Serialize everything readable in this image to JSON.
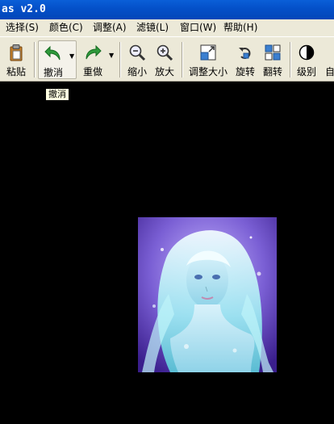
{
  "window": {
    "title_fragment": "as v2.0"
  },
  "menu": [
    "选择(S)",
    "颜色(C)",
    "调整(A)",
    "滤镜(L)",
    "窗口(W)",
    "帮助(H)"
  ],
  "toolbar": {
    "paste": "粘贴",
    "undo": "撤消",
    "redo": "重做",
    "zoom_out": "缩小",
    "zoom_in": "放大",
    "resize": "调整大小",
    "rotate": "旋转",
    "flip": "翻转",
    "levels": "级别",
    "auto": "自"
  },
  "tooltip": "撤消",
  "colors": {
    "titlebar": "#0450c8",
    "chrome": "#ece9d8",
    "canvas": "#000000",
    "tooltip": "#ffffe1"
  },
  "icons": [
    "clipboard-icon",
    "undo-arrow-icon",
    "redo-arrow-icon",
    "zoom-out-icon",
    "zoom-in-icon",
    "resize-icon",
    "rotate-icon",
    "flip-icon",
    "levels-icon"
  ]
}
